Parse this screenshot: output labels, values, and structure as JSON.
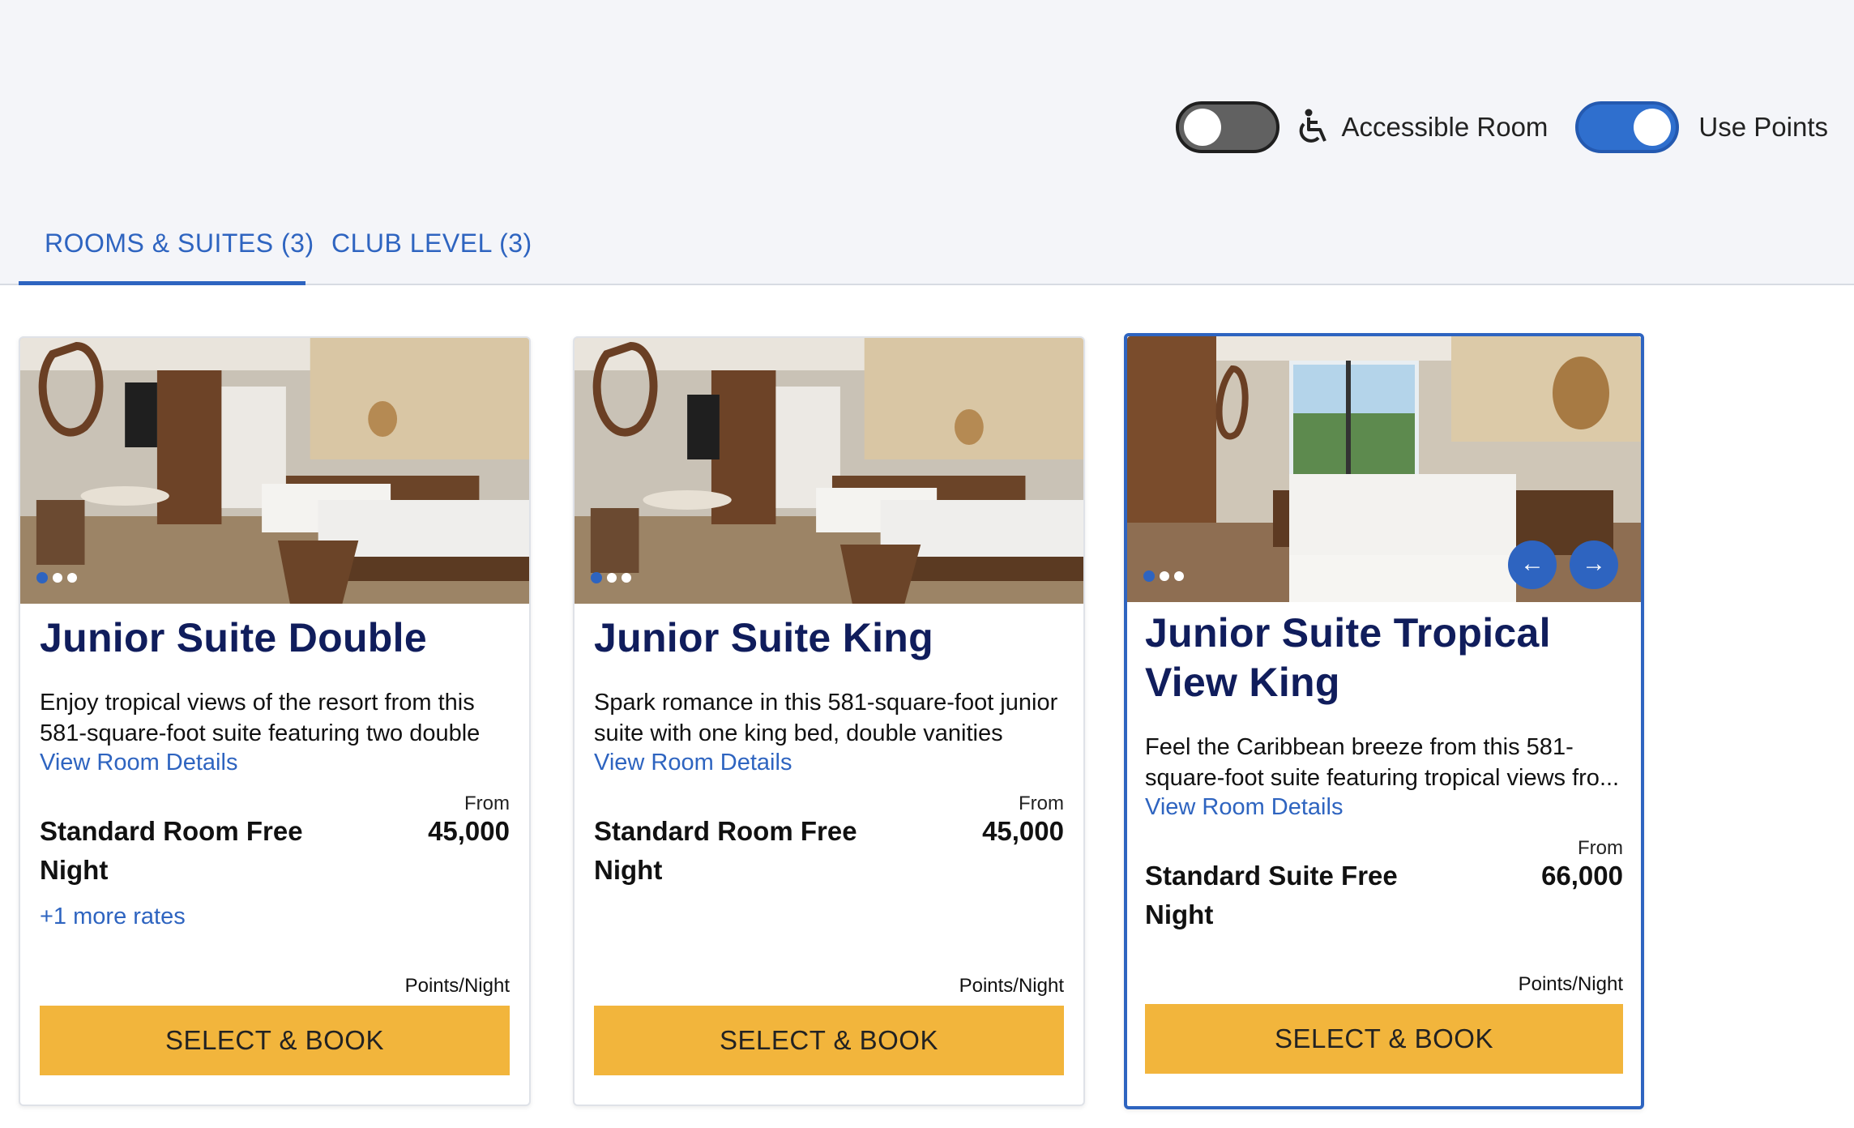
{
  "filters": {
    "accessible_room": {
      "label": "Accessible Room",
      "on": false
    },
    "use_points": {
      "label": "Use Points",
      "on": true
    }
  },
  "tabs": [
    {
      "label": "ROOMS & SUITES (3)",
      "active": true
    },
    {
      "label": "CLUB LEVEL (3)",
      "active": false
    }
  ],
  "rooms": [
    {
      "title": "Junior Suite Double",
      "description": "Enjoy tropical views of the resort from this 581-square-foot suite featuring two double beds, ...",
      "details_link": "View Room Details",
      "from_label": "From",
      "rate_name": "Standard Room Free Night",
      "price": "45,000",
      "more_rates": "+1 more rates",
      "unit": "Points/Night",
      "button": "SELECT & BOOK"
    },
    {
      "title": "Junior Suite King",
      "description": "Spark romance in this 581-square-foot junior suite with one king bed, double vanities and...",
      "details_link": "View Room Details",
      "from_label": "From",
      "rate_name": "Standard Room Free Night",
      "price": "45,000",
      "unit": "Points/Night",
      "button": "SELECT & BOOK"
    },
    {
      "title": "Junior Suite Tropical View King",
      "description": "Feel the Caribbean breeze from this 581-square-foot suite featuring tropical views fro...",
      "details_link": "View Room Details",
      "from_label": "From",
      "rate_name": "Standard Suite Free Night",
      "price": "66,000",
      "unit": "Points/Night",
      "button": "SELECT & BOOK",
      "carousel": {
        "prev": "←",
        "next": "→"
      }
    }
  ],
  "colors": {
    "accent": "#2e64c0",
    "title": "#101d5c",
    "cta": "#f2b53c"
  }
}
